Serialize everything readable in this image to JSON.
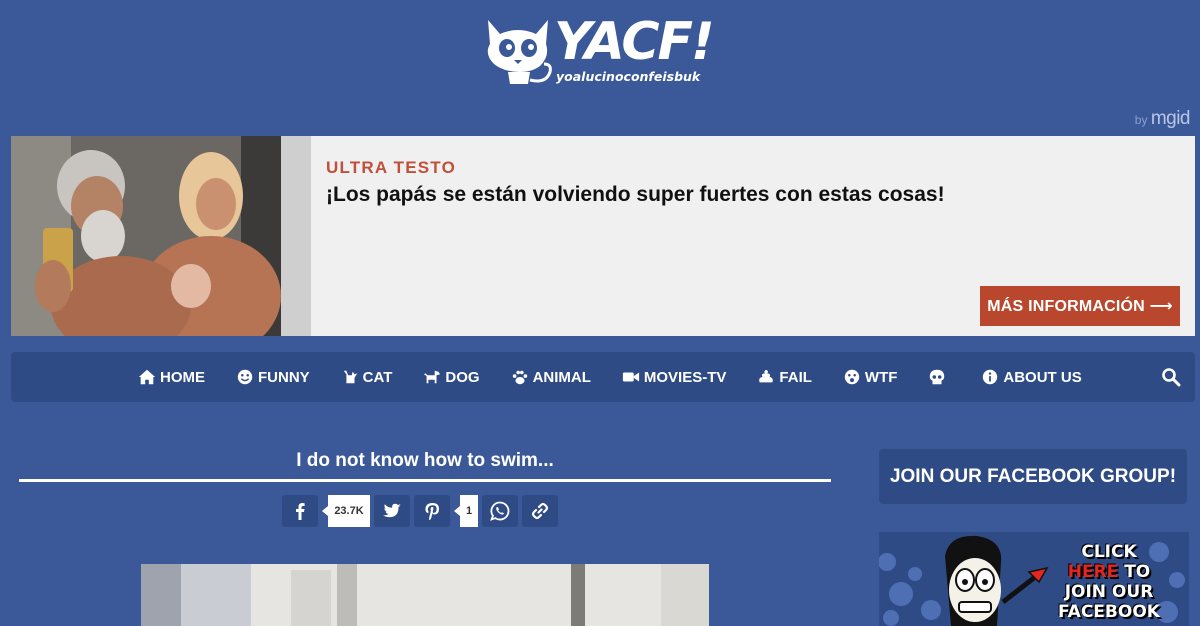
{
  "site": {
    "brand": "YACF!",
    "tagline": "yoalucinoconfeisbuk"
  },
  "ad": {
    "byline": "by",
    "network": "mgid",
    "advertiser": "ULTRA TESTO",
    "headline": "¡Los papás se están volviendo super fuertes con estas cosas!",
    "cta": "MÁS INFORMACIÓN ⟶"
  },
  "nav": {
    "items": [
      {
        "label": "HOME",
        "icon": "home-icon"
      },
      {
        "label": "FUNNY",
        "icon": "smile-icon"
      },
      {
        "label": "CAT",
        "icon": "cat-icon"
      },
      {
        "label": "DOG",
        "icon": "dog-icon"
      },
      {
        "label": "ANIMAL",
        "icon": "paw-icon"
      },
      {
        "label": "MOVIES-TV",
        "icon": "video-icon"
      },
      {
        "label": "FAIL",
        "icon": "poop-icon"
      },
      {
        "label": "WTF",
        "icon": "surprise-icon"
      },
      {
        "label": "",
        "icon": "skull-icon"
      },
      {
        "label": "ABOUT US",
        "icon": "info-icon"
      }
    ],
    "search_icon": "search-icon"
  },
  "post": {
    "title": "I do not know how to swim...",
    "share": {
      "facebook_count": "23.7K",
      "pinterest_count": "1"
    }
  },
  "sidebar": {
    "fb_group_label": "JOIN OUR FACEBOOK GROUP!",
    "banner": {
      "line1": "CLICK",
      "line2_red": "HERE",
      "line2_rest": " TO",
      "line3": "JOIN OUR",
      "line4": "FACEBOOK"
    }
  },
  "colors": {
    "background": "#3b5998",
    "nav": "#2f4b85",
    "ad_accent": "#c0503a",
    "cta": "#b9472e"
  }
}
